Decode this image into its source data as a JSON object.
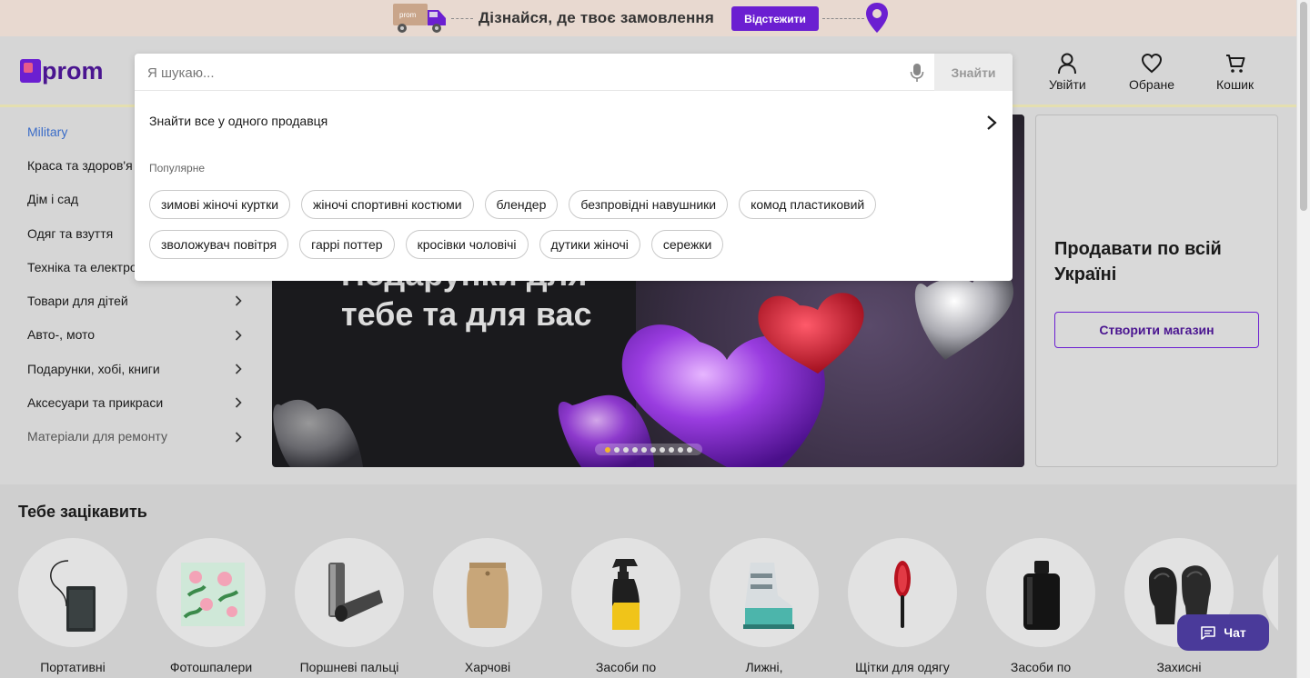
{
  "promo": {
    "text": "Дізнайся, де твоє замовлення",
    "button": "Відстежити",
    "truck_label": "prom"
  },
  "header": {
    "logo": "prom",
    "nav": [
      {
        "label": "Увійти",
        "icon": "user-icon"
      },
      {
        "label": "Обране",
        "icon": "heart-icon"
      },
      {
        "label": "Кошик",
        "icon": "cart-icon"
      }
    ]
  },
  "search": {
    "placeholder": "Я шукаю...",
    "value": "",
    "button": "Знайти",
    "seller_link": "Знайти все у одного продавця",
    "popular_label": "Популярне",
    "chips": [
      "зимові жіночі куртки",
      "жіночі спортивні костюми",
      "блендер",
      "безпровідні навушники",
      "комод пластиковий",
      "зволожувач повітря",
      "гаррі поттер",
      "кросівки чоловічі",
      "дутики жіночі",
      "сережки"
    ]
  },
  "sidebar": {
    "categories": [
      {
        "label": "Military",
        "chevron": false
      },
      {
        "label": "Краса та здоров'я",
        "chevron": true
      },
      {
        "label": "Дім і сад",
        "chevron": true
      },
      {
        "label": "Одяг та взуття",
        "chevron": true
      },
      {
        "label": "Техніка та електроніка",
        "chevron": true
      },
      {
        "label": "Товари для дітей",
        "chevron": true
      },
      {
        "label": "Авто-, мото",
        "chevron": true
      },
      {
        "label": "Подарунки, хобі, книги",
        "chevron": true
      },
      {
        "label": "Аксесуари та прикраси",
        "chevron": true
      },
      {
        "label": "Матеріали для ремонту",
        "chevron": true
      }
    ]
  },
  "banner": {
    "line1": "Подарунки для",
    "line2": "тебе та для вас",
    "slides": 10,
    "active_slide": 0
  },
  "seller_card": {
    "title": "Продавати по всій Україні",
    "button": "Створити магазин"
  },
  "interests": {
    "title": "Тебе зацікавить",
    "items": [
      {
        "label": "Портативні",
        "icon": "powerbank-icon"
      },
      {
        "label": "Фотошпалери",
        "icon": "wallpaper-icon"
      },
      {
        "label": "Поршневі пальці",
        "icon": "piston-pin-icon"
      },
      {
        "label": "Харчові",
        "icon": "food-bag-icon"
      },
      {
        "label": "Засоби по",
        "icon": "spray-bottle-icon"
      },
      {
        "label": "Лижні,",
        "icon": "ski-boot-icon"
      },
      {
        "label": "Щітки для одягу",
        "icon": "clothes-brush-icon"
      },
      {
        "label": "Засоби по",
        "icon": "cologne-bottle-icon"
      },
      {
        "label": "Захисні",
        "icon": "boxing-gloves-icon"
      }
    ]
  },
  "chat": {
    "label": "Чат"
  },
  "colors": {
    "brand": "#6b1fd1",
    "active_category": "#3a6cc8",
    "slide_active": "#f2b72c",
    "chat_bg": "#4a3a9a"
  }
}
